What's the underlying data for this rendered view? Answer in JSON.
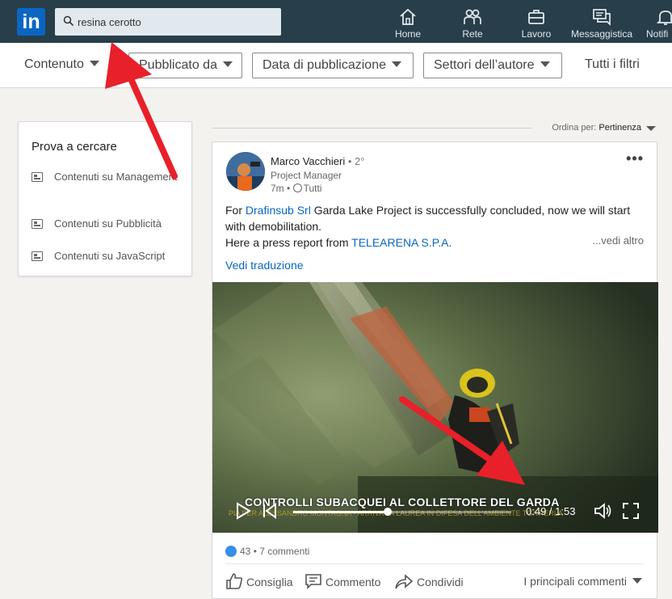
{
  "nav": {
    "logo": "in",
    "search_value": "resina cerotto",
    "items": [
      {
        "label": "Home",
        "icon": "home-icon"
      },
      {
        "label": "Rete",
        "icon": "network-icon"
      },
      {
        "label": "Lavoro",
        "icon": "briefcase-icon"
      },
      {
        "label": "Messaggistica",
        "icon": "messaging-icon"
      },
      {
        "label": "Notifi",
        "icon": "bell-icon"
      }
    ]
  },
  "filters": {
    "items": [
      "Contenuto",
      "Pubblicato da",
      "Data di pubblicazione",
      "Settori dell’autore"
    ],
    "all_filters": "Tutti i filtri"
  },
  "sidebar": {
    "title": "Prova a cercare",
    "suggestions": [
      "Contenuti su Management",
      "Contenuti su Pubblicità",
      "Contenuti su JavaScript"
    ]
  },
  "sort": {
    "label": "Ordina per:",
    "value": "Pertinenza"
  },
  "post": {
    "author": "Marco Vacchieri",
    "degree": "• 2°",
    "headline": "Project Manager",
    "time": "7m •",
    "visibility": "Tutti",
    "text_1_before": "For ",
    "mention_1": "Drafinsub Srl",
    "text_1_after": " Garda Lake Project is successfully concluded, now we will start with demobilitation.",
    "text_2_before": "Here a press report from ",
    "mention_2": "TELEARENA S.P.A.",
    "see_more": "...vedi altro",
    "translate": "Vedi traduzione",
    "video": {
      "caption": "CONTROLLI SUBACQUEI AL COLLETTORE DEL GARDA",
      "ticker": "PIA PER ALESSANDRO MONTAGNA - ARRIVA LA LAUREA IN DIFESA DELL'AMBIENTE TGA PERLA",
      "time": "0:49 / 1:53",
      "progress": 0.434
    },
    "likes": "43",
    "comments": "• 7 commenti",
    "actions": [
      "Consiglia",
      "Commento",
      "Condividi"
    ],
    "top_comments": "I principali commenti"
  },
  "colors": {
    "nav_bg": "#283e4a",
    "brand": "#0a66c2",
    "annotation_arrow": "#e8202a"
  }
}
